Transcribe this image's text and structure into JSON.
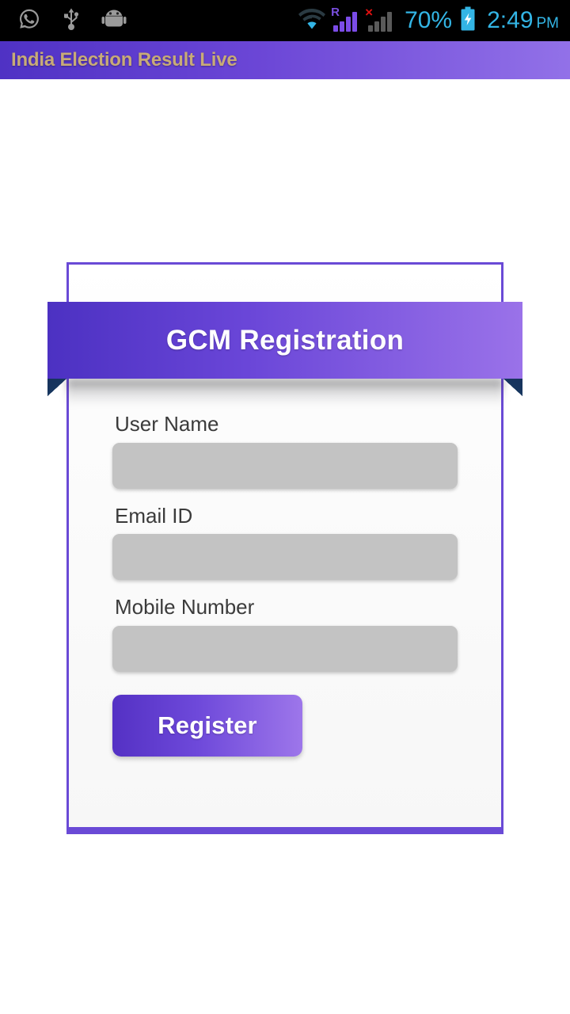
{
  "status_bar": {
    "background_color": "#000000",
    "accent_color": "#33b5e5",
    "left_icons": [
      {
        "name": "whatsapp-icon",
        "label": "WhatsApp"
      },
      {
        "name": "usb-icon",
        "label": "USB connected"
      },
      {
        "name": "android-robot-icon",
        "label": "Android system"
      }
    ],
    "wifi": {
      "name": "wifi-icon",
      "label": "Wi-Fi connected",
      "color": "#33b5e5"
    },
    "sim1": {
      "name": "signal-bars-icon",
      "label": "Signal bars",
      "roaming_indicator": "R",
      "color": "#7b4ce8"
    },
    "sim2": {
      "name": "signal-bars-no-service-icon",
      "label": "No service",
      "marker": "×",
      "color": "#5a5a5a"
    },
    "battery_percent": "70%",
    "battery_icon": {
      "name": "battery-charging-icon",
      "label": "Battery charging"
    },
    "time": "2:49",
    "time_period": "PM"
  },
  "app_bar": {
    "title": "India Election Result Live",
    "title_color": "#c8ab77",
    "gradient_start": "#4f32c4",
    "gradient_end": "#9271e8"
  },
  "card": {
    "ribbon": {
      "title": "GCM Registration",
      "gradient_start": "#4c31c2",
      "gradient_end": "#9a72e9",
      "fold_color": "#16325c",
      "text_color": "#ffffff"
    },
    "border_color": "#6a4ad6",
    "background_color": "#f7f7f7",
    "fields": [
      {
        "name": "user-name",
        "label": "User Name",
        "value": "",
        "placeholder": ""
      },
      {
        "name": "email-id",
        "label": "Email ID",
        "value": "",
        "placeholder": ""
      },
      {
        "name": "mobile-number",
        "label": "Mobile Number",
        "value": "",
        "placeholder": ""
      }
    ],
    "submit_button": {
      "label": "Register",
      "gradient_start": "#5431c4",
      "gradient_end": "#9d76ea",
      "text_color": "#ffffff"
    }
  }
}
